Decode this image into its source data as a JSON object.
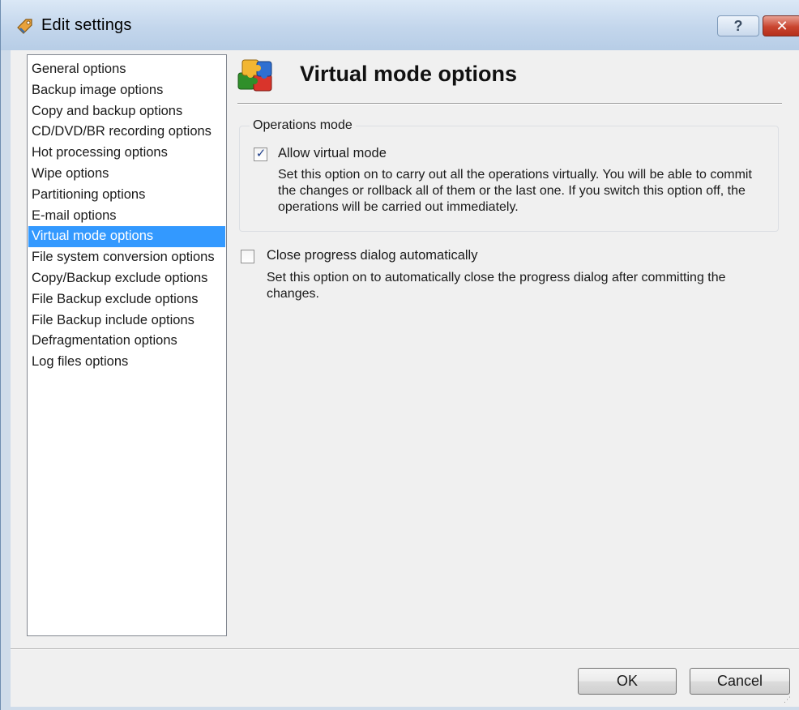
{
  "window": {
    "title": "Edit settings",
    "help_label": "?",
    "close_label": "✕"
  },
  "sidebar": {
    "items": [
      {
        "label": "General options"
      },
      {
        "label": "Backup image options"
      },
      {
        "label": "Copy and backup options"
      },
      {
        "label": "CD/DVD/BR recording options"
      },
      {
        "label": "Hot processing options"
      },
      {
        "label": "Wipe options"
      },
      {
        "label": "Partitioning options"
      },
      {
        "label": "E-mail options"
      },
      {
        "label": "Virtual mode options",
        "selected": true
      },
      {
        "label": "File system conversion options"
      },
      {
        "label": "Copy/Backup exclude options"
      },
      {
        "label": "File Backup exclude options"
      },
      {
        "label": "File Backup include options"
      },
      {
        "label": "Defragmentation options"
      },
      {
        "label": "Log files options"
      }
    ]
  },
  "main": {
    "title": "Virtual mode options",
    "header_icon": "puzzle-icon",
    "group": {
      "legend": "Operations mode",
      "option": {
        "label": "Allow virtual mode",
        "checked": true,
        "description": "Set this option on to carry out all the operations virtually. You will be able to commit the changes or rollback all of them or the last one. If you switch this option off, the operations will be carried out immediately."
      }
    },
    "option2": {
      "label": "Close progress dialog automatically",
      "checked": false,
      "description": "Set this option on to automatically close the progress dialog after committing the changes."
    }
  },
  "footer": {
    "ok_label": "OK",
    "cancel_label": "Cancel"
  },
  "colors": {
    "selection": "#3399ff",
    "title_bar": "#c3d6ec",
    "close_button": "#c9442f"
  }
}
